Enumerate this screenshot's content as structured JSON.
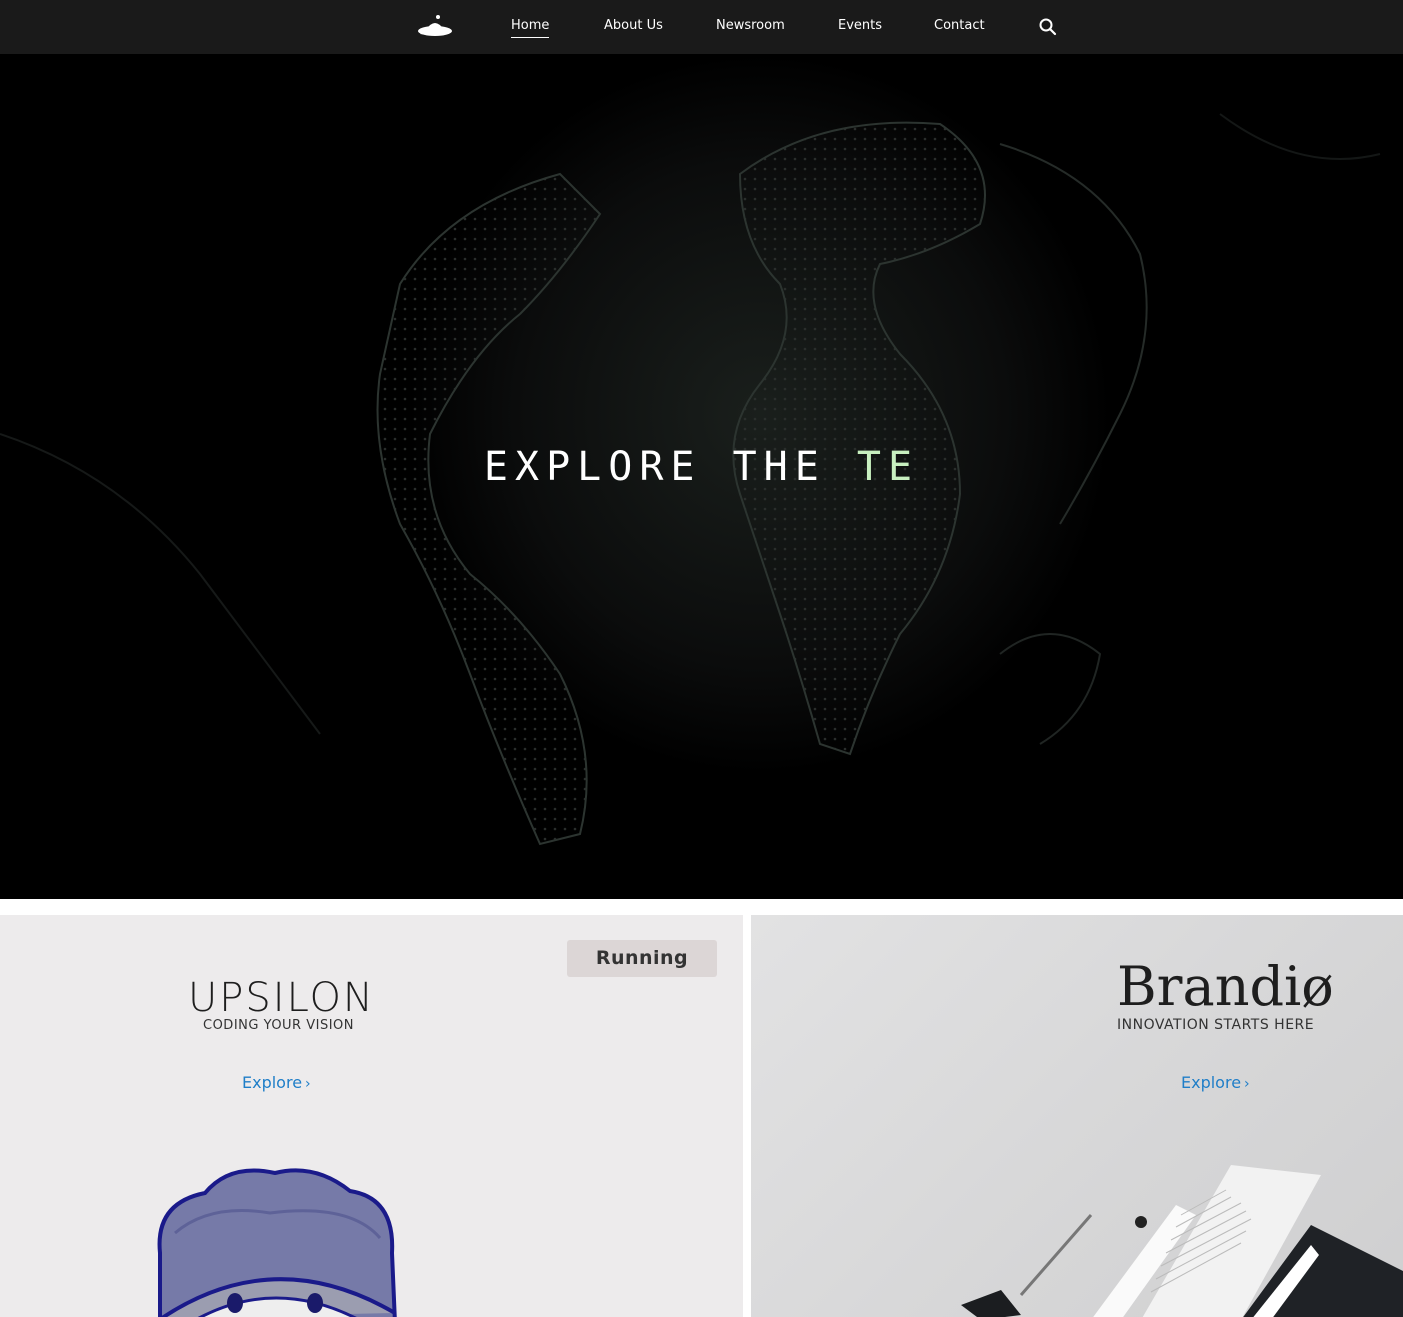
{
  "nav": {
    "logo_icon": "ufo-logo-icon",
    "items": [
      {
        "label": "Home",
        "active": true
      },
      {
        "label": "About Us",
        "active": false
      },
      {
        "label": "Newsroom",
        "active": false
      },
      {
        "label": "Events",
        "active": false
      },
      {
        "label": "Contact",
        "active": false
      }
    ],
    "search_icon": "search-icon"
  },
  "hero": {
    "headline_main": "EXPLORE THE ",
    "headline_accent": "TE",
    "accent_color": "#c8f0c0",
    "background": "dark-world-map"
  },
  "cards": {
    "left": {
      "badge": "Running",
      "brand": "UPSILON",
      "tagline": "CODING YOUR  VISION",
      "cta": "Explore",
      "cta_color": "#1f7ec8"
    },
    "right": {
      "brand": "Brandiø",
      "tagline": "INNOVATION STARTS HERE",
      "cta": "Explore",
      "cta_color": "#1f7ec8"
    }
  }
}
